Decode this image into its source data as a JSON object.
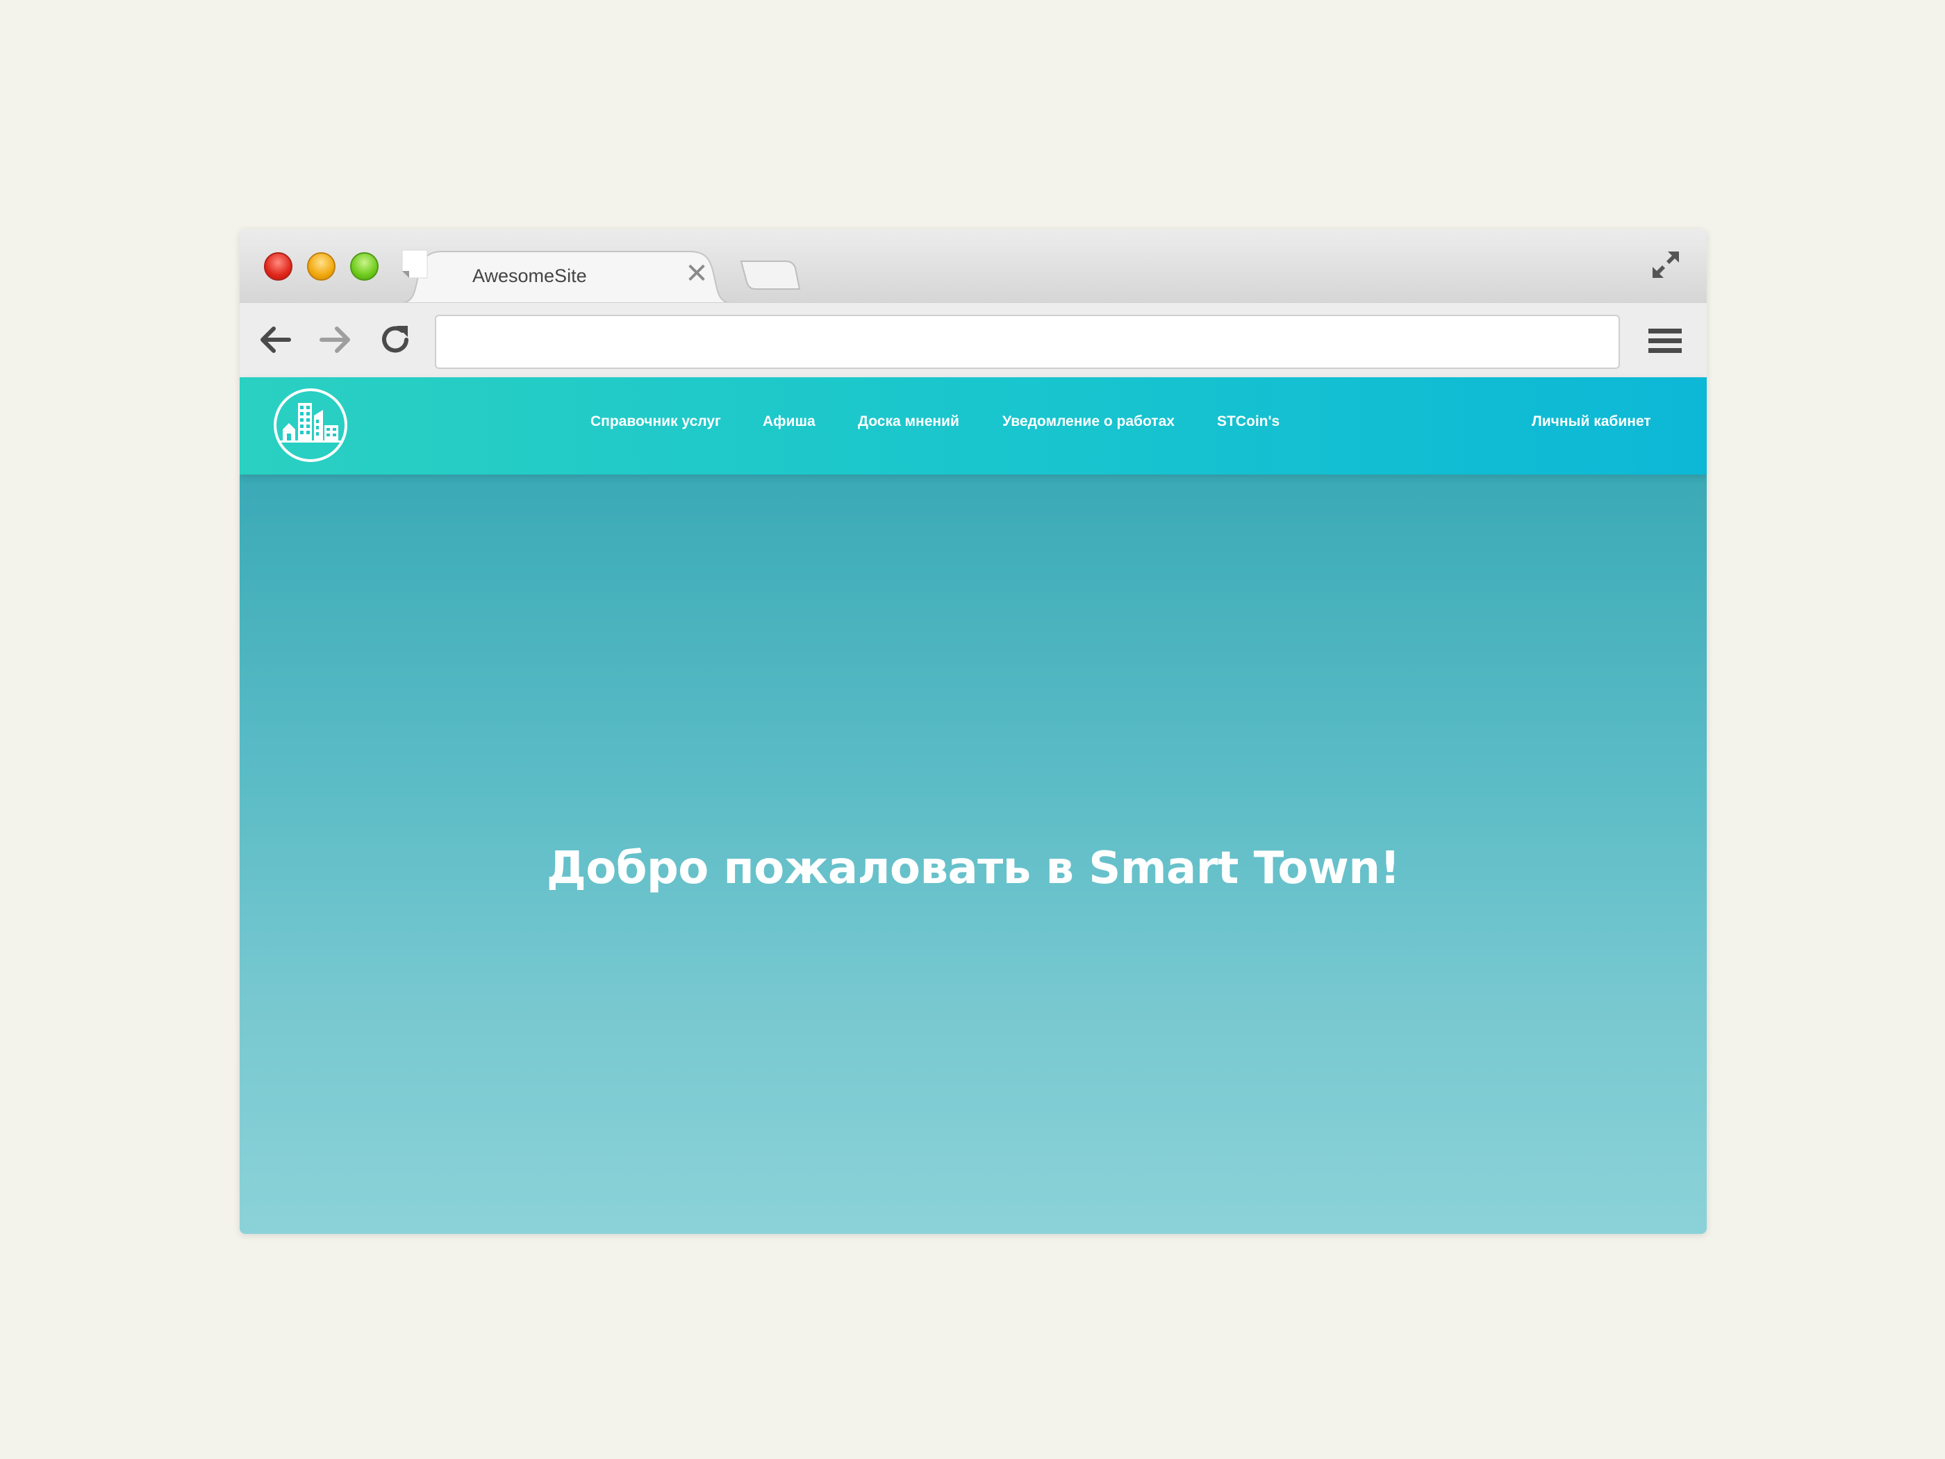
{
  "browser": {
    "tab_title": "AwesomeSite",
    "tab_close": "✕",
    "address": ""
  },
  "site": {
    "nav": [
      {
        "label": "Справочник услуг"
      },
      {
        "label": "Афиша"
      },
      {
        "label": "Доска мнений"
      },
      {
        "label": "Уведомление о работах"
      },
      {
        "label": "STCoin's"
      }
    ],
    "account_label": "Личный кабинет",
    "hero_title": "Добро пожаловать в Smart Town!"
  },
  "colors": {
    "header_start": "#2ad0c1",
    "header_end": "#0cb8d6",
    "hero_top": "#3aaab6",
    "hero_bottom": "#8bd2d8"
  },
  "icons": {
    "logo": "city-buildings-icon",
    "back": "arrow-left-icon",
    "forward": "arrow-right-icon",
    "reload": "reload-icon",
    "menu": "hamburger-menu-icon",
    "fullscreen": "fullscreen-icon"
  }
}
